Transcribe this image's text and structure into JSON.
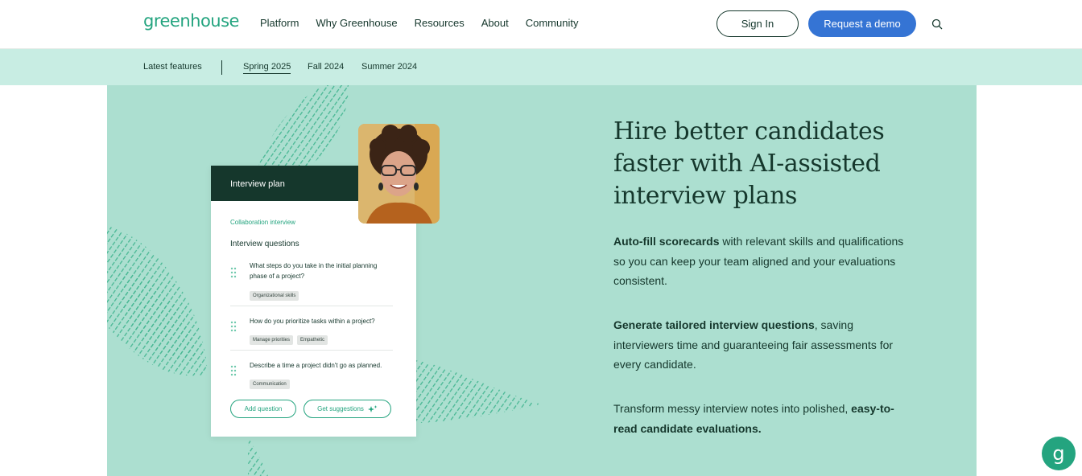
{
  "header": {
    "logo": "greenhouse",
    "nav": [
      "Platform",
      "Why Greenhouse",
      "Resources",
      "About",
      "Community"
    ],
    "sign_in": "Sign In",
    "request_demo": "Request a demo",
    "search_icon": "search-icon"
  },
  "subnav": {
    "latest": "Latest features",
    "items": [
      "Spring 2025",
      "Fall 2024",
      "Summer 2024"
    ],
    "active": "Spring 2025"
  },
  "card": {
    "title": "Interview plan",
    "subtitle": "Collaboration interview",
    "questions_heading": "Interview questions",
    "questions": [
      {
        "text": "What steps do you take in the initial planning phase of a project?",
        "tags": [
          "Organizational skills"
        ]
      },
      {
        "text": "How do you prioritize tasks within a project?",
        "tags": [
          "Manage priorities",
          "Empathetic"
        ]
      },
      {
        "text": "Describe a time a project didn't go as planned.",
        "tags": [
          "Communication"
        ]
      }
    ],
    "add_question": "Add question",
    "get_suggestions": "Get suggestions"
  },
  "hero": {
    "title": "Hire better candidates faster with AI-assisted interview plans",
    "p1_bold": "Auto-fill scorecards",
    "p1_rest": " with relevant skills and qualifications so you can keep your team aligned and your evaluations consistent.",
    "p2_bold": "Generate tailored interview questions",
    "p2_rest": ", saving interviewers time and guaranteeing fair assessments for every candidate.",
    "p3_rest": "Transform messy interview notes into polished, ",
    "p3_bold": "easy-to-read candidate evaluations."
  },
  "chat": {
    "glyph": "g"
  },
  "colors": {
    "brand_green": "#24a47f",
    "dark_green": "#15372c",
    "hero_bg": "#acdfd0",
    "subnav_bg": "#c8ede3",
    "demo_blue": "#3574d4"
  }
}
